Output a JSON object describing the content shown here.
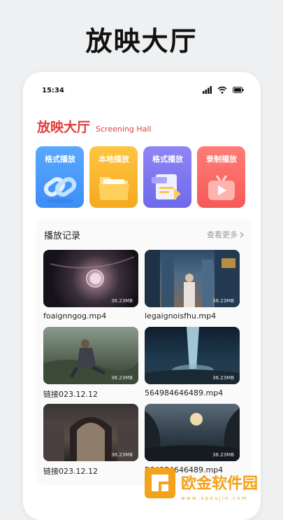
{
  "banner": {
    "title": "放映大厅"
  },
  "status": {
    "time": "15:34"
  },
  "header": {
    "title": "放映大厅",
    "subtitle": "Screening Hall"
  },
  "tiles": [
    {
      "label": "格式播放",
      "icon": "chain-link-icon"
    },
    {
      "label": "本地播放",
      "icon": "folder-icon"
    },
    {
      "label": "格式播放",
      "icon": "document-icon"
    },
    {
      "label": "录制播放",
      "icon": "video-play-icon"
    }
  ],
  "history": {
    "title": "播放记录",
    "more": "查看更多",
    "items": [
      {
        "name": "foaignngog.mp4",
        "size": "36.23MB"
      },
      {
        "name": "legaignoisfhu.mp4",
        "size": "36.23MB"
      },
      {
        "name": "链接023.12.12",
        "size": "36.23MB"
      },
      {
        "name": "564984646489.mp4",
        "size": "36.23MB"
      },
      {
        "name": "链接023.12.12",
        "size": "36.23MB"
      },
      {
        "name": "564984646489.mp4",
        "size": "36.23MB"
      }
    ]
  },
  "watermark": {
    "brand": "欧金软件园",
    "url": "w w w . a p o u j i n . c o m"
  },
  "colors": {
    "accent": "#e13c3c",
    "tile1": "#4a9bfb",
    "tile2": "#f8b630",
    "tile3": "#7f79ef",
    "tile4": "#f76a66"
  }
}
